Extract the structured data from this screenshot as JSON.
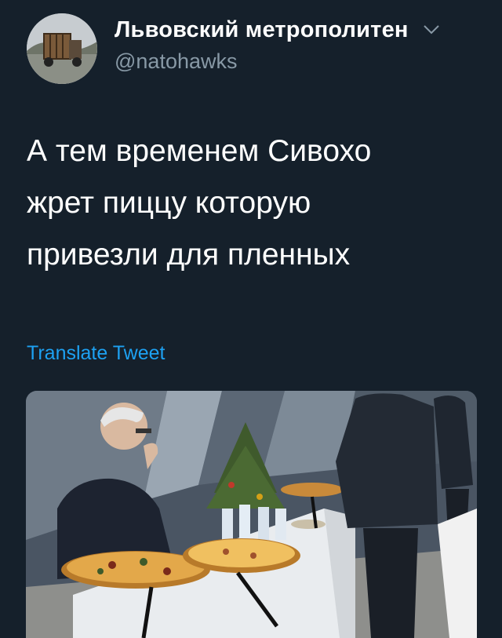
{
  "author": {
    "display_name": "Львовский метрополитен",
    "handle": "@natohawks",
    "avatar_icon": "avatar-photo",
    "menu_icon": "chevron-down-icon"
  },
  "tweet": {
    "text_lines": [
      "А тем временем Сивохо",
      "жрет пиццу которую",
      "привезли для пленных"
    ],
    "translate_label": "Translate Tweet"
  },
  "colors": {
    "background": "#15202b",
    "text": "#ffffff",
    "secondary": "#8899a6",
    "link": "#1da1f2"
  }
}
